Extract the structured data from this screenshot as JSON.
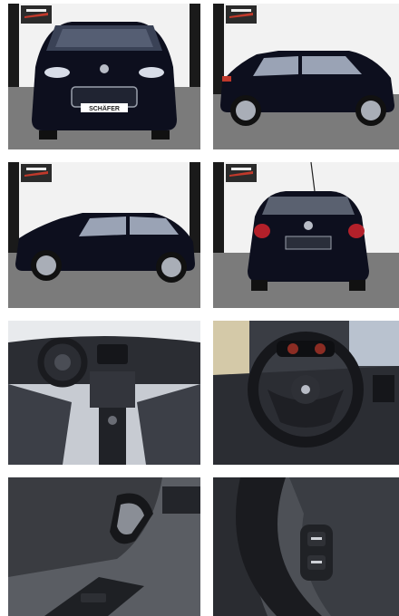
{
  "gallery": {
    "photos": [
      {
        "id": "front",
        "plate_text": "SCHÄFER"
      },
      {
        "id": "side-right"
      },
      {
        "id": "side-left"
      },
      {
        "id": "rear"
      },
      {
        "id": "dashboard"
      },
      {
        "id": "steering-wheel"
      },
      {
        "id": "door-handle"
      },
      {
        "id": "wheel-controls"
      }
    ]
  },
  "colors": {
    "car_body": "#0d0f1e",
    "studio_wall": "#f2f2f2",
    "studio_floor": "#7b7b7b",
    "interior_dark": "#2b2d33",
    "interior_mid": "#4a4d55"
  },
  "icons": {
    "badge": "dealer-logo-icon",
    "emblem": "peugeot-lion-icon"
  }
}
